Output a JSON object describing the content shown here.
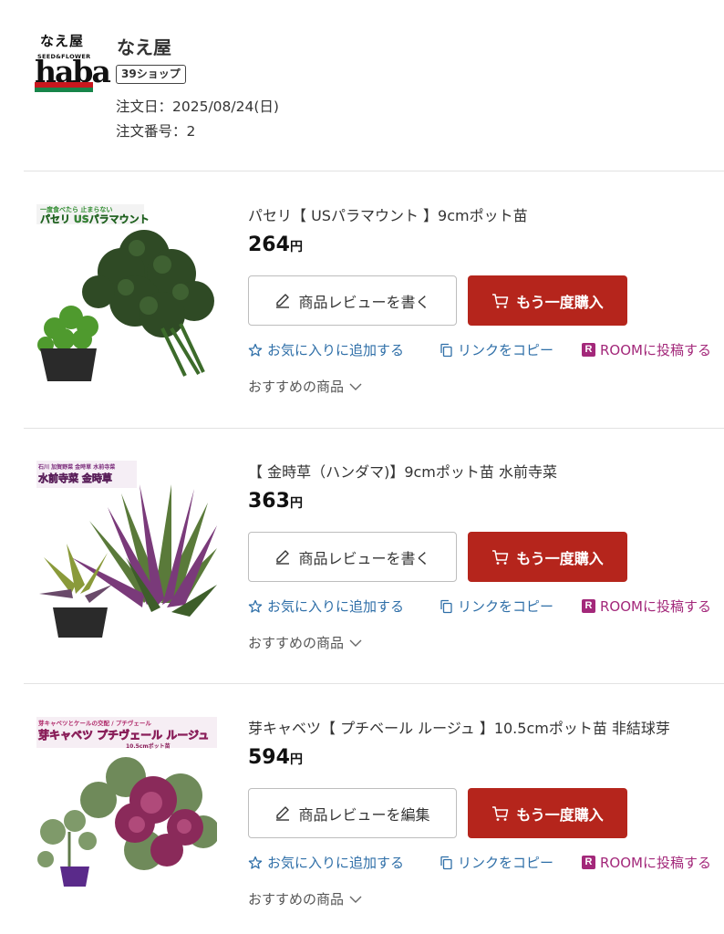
{
  "shop": {
    "logo_top": "なえ屋",
    "logo_sub": "SEED&FLOWER",
    "logo_main": "haba",
    "name": "なえ屋",
    "badge": "39ショップ",
    "order_date": "注文日：2025/08/24(日)",
    "order_number": "注文番号：2"
  },
  "products": [
    {
      "title": "パセリ【 USパラマウント 】9cmポット苗",
      "price": "264",
      "yen": "円",
      "review_label": "商品レビューを書く",
      "rebuy_label": "もう一度購入",
      "favorite_label": "お気に入りに追加する",
      "copy_label": "リンクをコピー",
      "room_label": "ROOMに投稿する",
      "room_badge": "R",
      "recommend_label": "おすすめの商品"
    },
    {
      "title": "【 金時草（ハンダマ)】9cmポット苗 水前寺菜",
      "price": "363",
      "yen": "円",
      "review_label": "商品レビューを書く",
      "rebuy_label": "もう一度購入",
      "favorite_label": "お気に入りに追加する",
      "copy_label": "リンクをコピー",
      "room_label": "ROOMに投稿する",
      "room_badge": "R",
      "recommend_label": "おすすめの商品"
    },
    {
      "title": "芽キャベツ【 プチベール ルージュ 】10.5cmポット苗 非結球芽",
      "price": "594",
      "yen": "円",
      "review_label": "商品レビューを編集",
      "rebuy_label": "もう一度購入",
      "favorite_label": "お気に入りに追加する",
      "copy_label": "リンクをコピー",
      "room_label": "ROOMに投稿する",
      "room_badge": "R",
      "recommend_label": "おすすめの商品"
    }
  ],
  "colors": {
    "rebuy": "#b5251c",
    "link": "#2f6fa8",
    "room": "#a3287a"
  },
  "icons": {
    "review": "pencil-icon",
    "rebuy": "cart-icon",
    "favorite": "star-outline-icon",
    "copy": "copy-icon",
    "recommend": "chevron-down-icon"
  }
}
